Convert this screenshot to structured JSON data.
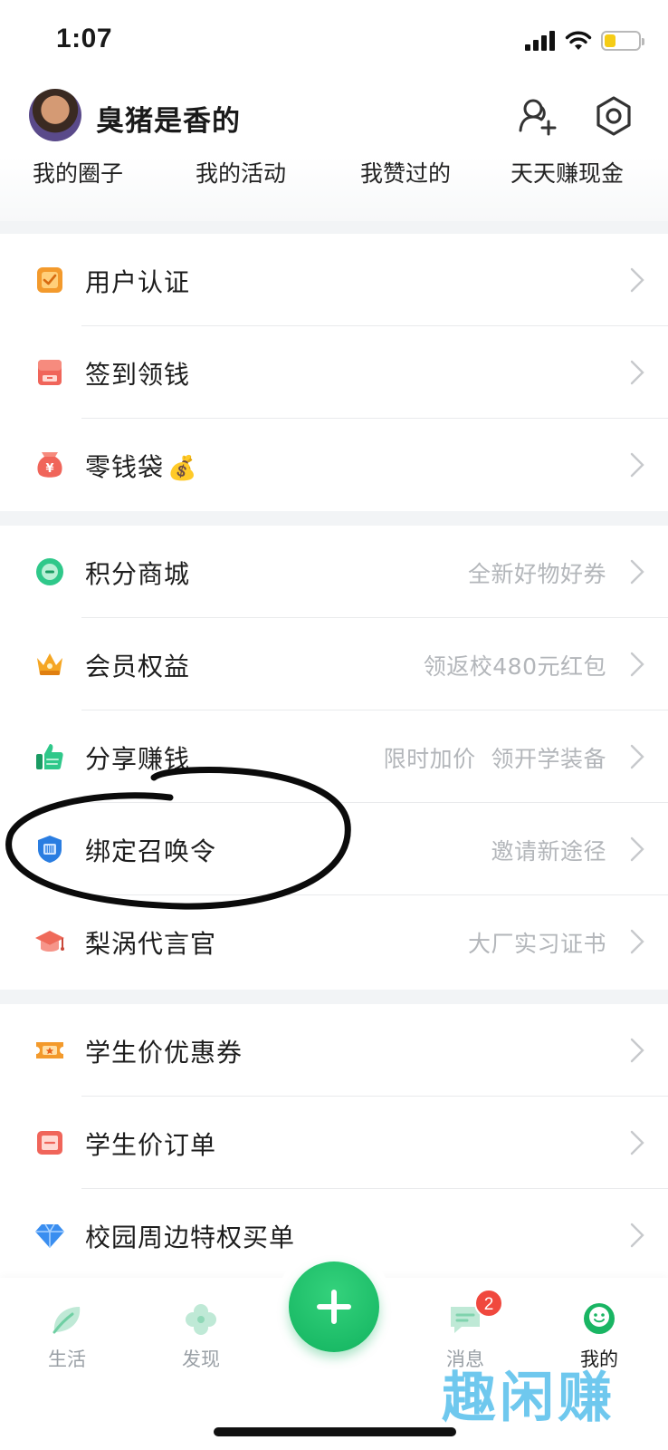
{
  "status_bar": {
    "time": "1:07"
  },
  "header": {
    "user_name": "臭猪是香的"
  },
  "quick_links": [
    "我的圈子",
    "我的活动",
    "我赞过的",
    "天天赚现金"
  ],
  "sections": [
    [
      {
        "label": "用户认证",
        "hint": "",
        "icon": "verify-icon",
        "color": "#f39a2c"
      },
      {
        "label": "签到领钱",
        "hint": "",
        "icon": "checkin-icon",
        "color": "#f0655a"
      },
      {
        "label": "零钱袋",
        "hint": "",
        "icon": "money-bag-icon",
        "color": "#f0655a",
        "emoji": "💰"
      }
    ],
    [
      {
        "label": "积分商城",
        "hint": "全新好物好券",
        "icon": "points-mall-icon",
        "color": "#2fc88a"
      },
      {
        "label": "会员权益",
        "hint": "领返校480元红包",
        "icon": "crown-icon",
        "color": "#f5a623"
      },
      {
        "label": "分享赚钱",
        "hint": "限时加价  领开学装备",
        "icon": "thumbs-up-icon",
        "color": "#2fc88a"
      },
      {
        "label": "绑定召唤令",
        "hint": "邀请新途径",
        "icon": "shield-icon",
        "color": "#2a7de1"
      },
      {
        "label": "梨涡代言官",
        "hint": "大厂实习证书",
        "icon": "graduation-cap-icon",
        "color": "#ef6a5a"
      }
    ],
    [
      {
        "label": "学生价优惠券",
        "hint": "",
        "icon": "coupon-icon",
        "color": "#f39a2c"
      },
      {
        "label": "学生价订单",
        "hint": "",
        "icon": "order-icon",
        "color": "#f0655a"
      },
      {
        "label": "校园周边特权买单",
        "hint": "",
        "icon": "diamond-icon",
        "color": "#3a8ef0"
      }
    ]
  ],
  "tabbar": {
    "tabs": [
      {
        "label": "生活",
        "icon": "life-icon"
      },
      {
        "label": "发现",
        "icon": "discover-icon"
      },
      {
        "label": "消息",
        "icon": "message-icon"
      },
      {
        "label": "我的",
        "icon": "profile-icon"
      }
    ],
    "message_badge": "2",
    "accent": "#12b35f"
  },
  "watermark": "趣闲赚"
}
